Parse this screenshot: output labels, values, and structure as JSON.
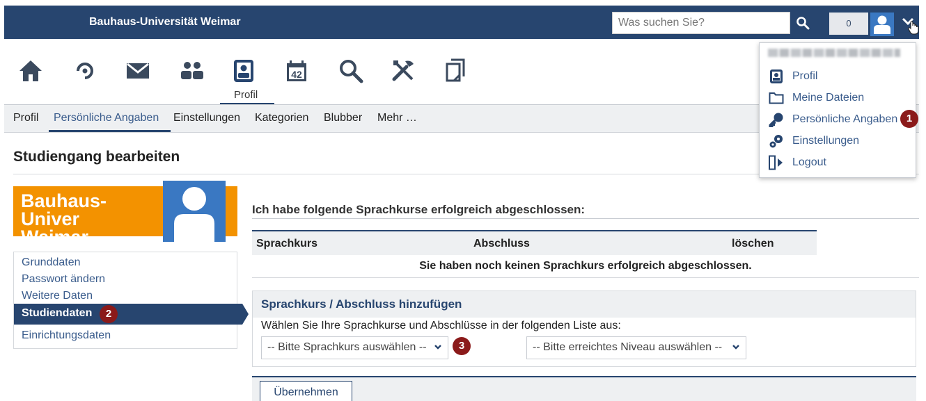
{
  "header": {
    "brand": "Bauhaus-Universität Weimar",
    "search_placeholder": "Was suchen Sie?",
    "counter": "0"
  },
  "iconbar": {
    "active_label": "Profil"
  },
  "subnav": [
    "Profil",
    "Persönliche Angaben",
    "Einstellungen",
    "Kategorien",
    "Blubber",
    "Mehr …"
  ],
  "page_title": "Studiengang bearbeiten",
  "logo_text": "Bauhaus-Univer\nWeimar",
  "left_menu": {
    "items": [
      "Grunddaten",
      "Passwort ändern",
      "Weitere Daten",
      "Studiendaten",
      "Einrichtungsdaten"
    ],
    "active": "Studiendaten"
  },
  "markers": [
    "1",
    "2",
    "3"
  ],
  "content": {
    "heading": "Ich habe folgende Sprachkurse erfolgreich abgeschlossen:",
    "columns": [
      "Sprachkurs",
      "Abschluss",
      "löschen"
    ],
    "empty_message": "Sie haben noch keinen Sprachkurs erfolgreich abgeschlossen.",
    "add_title": "Sprachkurs / Abschluss hinzufügen",
    "add_hint": "Wählen Sie Ihre Sprachkurse und Abschlüsse in der folgenden Liste aus:",
    "select_course": "-- Bitte Sprachkurs auswählen --",
    "select_level": "-- Bitte erreichtes Niveau auswählen --",
    "apply_button": "Übernehmen"
  },
  "dropdown": {
    "items": [
      "Profil",
      "Meine Dateien",
      "Persönliche Angaben",
      "Einstellungen",
      "Logout"
    ]
  },
  "colors": {
    "navy": "#27456f",
    "orange": "#f39200",
    "avatar_blue": "#3a78c2",
    "marker_red": "#8b1a1a",
    "link_blue": "#3a5c8c"
  }
}
